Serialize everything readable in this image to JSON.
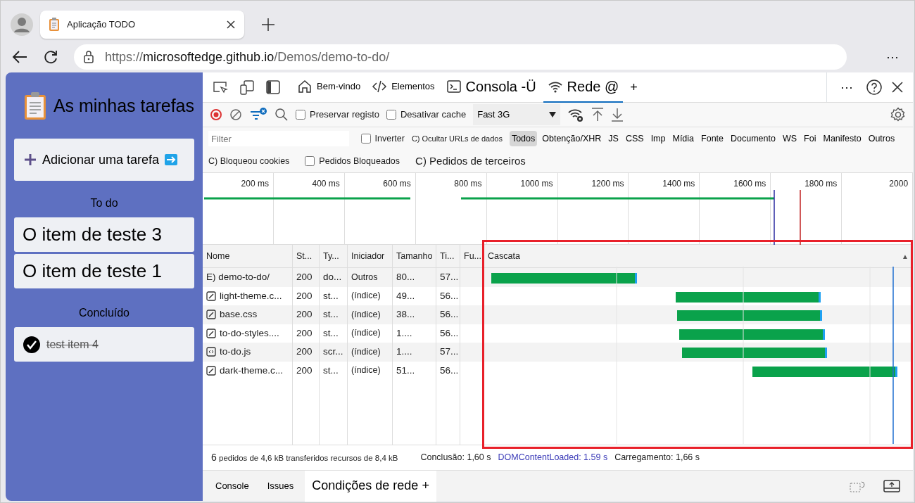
{
  "browser": {
    "tab": {
      "title": "Aplicação TODO"
    },
    "address": {
      "scheme": "https://",
      "host": "microsoftedge.github.io",
      "path": "/Demos/demo-to-do/"
    },
    "menu": "···"
  },
  "app": {
    "title": "As minhas tarefas",
    "add_task": "Adicionar uma tarefa",
    "sections": [
      {
        "heading": "To do",
        "items": [
          {
            "text": "O item de teste 3",
            "done": false
          },
          {
            "text": "O item de teste 1",
            "done": false
          }
        ]
      },
      {
        "heading": "Concluído",
        "items": [
          {
            "text": "test item 4",
            "done": true
          }
        ]
      }
    ]
  },
  "devtools": {
    "tabs": [
      {
        "label": "Bem-vindo",
        "selected": false
      },
      {
        "label": "Elementos",
        "selected": false
      },
      {
        "label": "Consola -Ü",
        "selected": false
      },
      {
        "label": "Rede @",
        "selected": true
      }
    ],
    "add_tab": "+",
    "more": "···",
    "toolbar": {
      "preserve_log": {
        "label": "Preservar registo",
        "checked": false
      },
      "disable_cache": {
        "label": "Desativar cache",
        "checked": false
      },
      "throttling": "Fast 3G"
    },
    "filter": {
      "placeholder": "Filter",
      "invert": {
        "label": "Inverter",
        "checked": false
      },
      "hide_data_urls": "C) Ocultar URLs de dados",
      "types": [
        {
          "label": "Todos",
          "selected": true
        },
        {
          "label": "Obtenção/XHR",
          "selected": false
        },
        {
          "label": "JS",
          "selected": false
        },
        {
          "label": "CSS",
          "selected": false
        },
        {
          "label": "Imp",
          "selected": false
        },
        {
          "label": "Mídia",
          "selected": false
        },
        {
          "label": "Fonte",
          "selected": false
        },
        {
          "label": "Documento",
          "selected": false
        },
        {
          "label": "WS",
          "selected": false
        },
        {
          "label": "Foi",
          "selected": false
        },
        {
          "label": "Manifesto",
          "selected": false
        },
        {
          "label": "Outros",
          "selected": false
        }
      ],
      "blocked_cookies": "C) Bloqueou cookies",
      "blocked_requests": {
        "label": "Pedidos Bloqueados",
        "checked": false
      },
      "third_party": "C) Pedidos de terceiros"
    },
    "overview": {
      "ticks": [
        "200 ms",
        "400 ms",
        "600 ms",
        "800 ms",
        "1000 ms",
        "1200 ms",
        "1400 ms",
        "1600 ms",
        "1800 ms",
        "2000"
      ]
    },
    "table": {
      "columns": [
        "Nome",
        "St...",
        "Ty...",
        "Iniciador",
        "Tamanho",
        "Ti...",
        "Fu...",
        "Cascata"
      ],
      "sort_indicator": "▲",
      "rows": [
        {
          "kind": "document",
          "name": "E) demo-to-do/",
          "status": "200",
          "type": "do...",
          "initiator": "Outros",
          "size": "80...",
          "time": "57..."
        },
        {
          "kind": "stylesheet",
          "name": "light-theme.c...",
          "status": "200",
          "type": "st...",
          "initiator": "(índice)",
          "size": "49...",
          "time": "56..."
        },
        {
          "kind": "stylesheet",
          "name": "base.css",
          "status": "200",
          "type": "st...",
          "initiator": "(índice)",
          "size": "38...",
          "time": "56..."
        },
        {
          "kind": "stylesheet",
          "name": "to-do-styles....",
          "status": "200",
          "type": "st...",
          "initiator": "(índice)",
          "size": "1....",
          "time": "56..."
        },
        {
          "kind": "script",
          "name": "to-do.js",
          "status": "200",
          "type": "scr...",
          "initiator": "(índice)",
          "size": "1....",
          "time": "57..."
        },
        {
          "kind": "stylesheet",
          "name": "dark-theme.c...",
          "status": "200",
          "type": "st...",
          "initiator": "(índice)",
          "size": "51...",
          "time": "56..."
        }
      ]
    },
    "status_bar": {
      "count": "6",
      "summary": "pedidos de 4,6 kB transferidos recursos de 8,4 kB",
      "finish": "Conclusão: 1,60 s",
      "dom_loaded": "DOMContentLoaded: 1.59 s",
      "load": "Carregamento: 1,66 s"
    },
    "drawer": {
      "tabs": [
        {
          "label": "Console",
          "selected": false
        },
        {
          "label": "Issues",
          "selected": false
        },
        {
          "label": "Condições de rede +",
          "selected": true
        }
      ]
    }
  }
}
